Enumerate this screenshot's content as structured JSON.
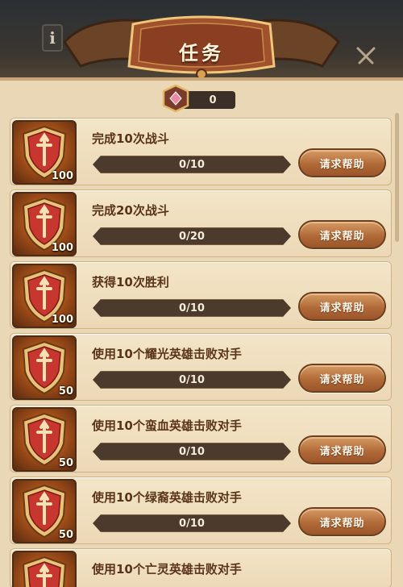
{
  "header": {
    "title": "任务",
    "info_label": "i"
  },
  "currency": {
    "amount": "0",
    "icon": "gem-icon"
  },
  "colors": {
    "panel": "#e9d7b6",
    "button": "#b16a37",
    "progress_bg": "#4c3a2d",
    "title_text": "#fff3dc"
  },
  "tasks": [
    {
      "name": "完成10次战斗",
      "points": "100",
      "progress_text": "0/10",
      "progress": 0,
      "button": "请求帮助"
    },
    {
      "name": "完成20次战斗",
      "points": "100",
      "progress_text": "0/20",
      "progress": 0,
      "button": "请求帮助"
    },
    {
      "name": "获得10次胜利",
      "points": "100",
      "progress_text": "0/10",
      "progress": 0,
      "button": "请求帮助"
    },
    {
      "name": "使用10个耀光英雄击败对手",
      "points": "50",
      "progress_text": "0/10",
      "progress": 0,
      "button": "请求帮助"
    },
    {
      "name": "使用10个蛮血英雄击败对手",
      "points": "50",
      "progress_text": "0/10",
      "progress": 0,
      "button": "请求帮助"
    },
    {
      "name": "使用10个绿裔英雄击败对手",
      "points": "50",
      "progress_text": "0/10",
      "progress": 0,
      "button": "请求帮助"
    },
    {
      "name": "使用10个亡灵英雄击败对手"
    }
  ]
}
